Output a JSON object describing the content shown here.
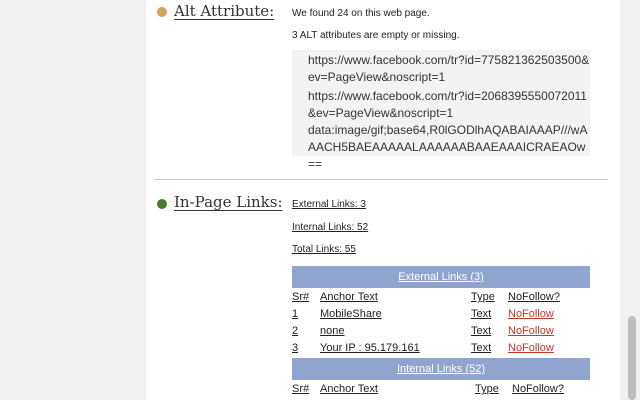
{
  "alt_section": {
    "title": "Alt Attribute:",
    "dot_color": "#d4a45a",
    "found_text": "We found 24 on this web page.",
    "empty_text": "3 ALT attributes are empty or missing.",
    "urls": [
      "https://www.facebook.com/tr?id=775821362503500&ev=PageView&noscript=1",
      "https://www.facebook.com/tr?id=2068395550072011&ev=PageView&noscript=1",
      "data:image/gif;base64,R0lGODlhAQABAIAAAP///wAAACH5BAEAAAAALAAAAAABAAEAAAICRAEAOw=="
    ]
  },
  "links_section": {
    "title": "In-Page Links:",
    "dot_color": "#4a7a2a",
    "external_count": "External Links: 3",
    "internal_count": "Internal Links: 52",
    "total_count": "Total Links: 55",
    "external_header": "External Links (3)",
    "internal_header": "Internal Links (52)",
    "columns": {
      "sr": "Sr#",
      "anchor": "Anchor Text",
      "type": "Type",
      "nofollow": "NoFollow?"
    },
    "external_rows": [
      {
        "sr": "1",
        "anchor": "MobileShare",
        "type": "Text",
        "nofollow": "NoFollow"
      },
      {
        "sr": "2",
        "anchor": "none",
        "type": "Text",
        "nofollow": "NoFollow"
      },
      {
        "sr": "3",
        "anchor": "Your IP : 95.179.161",
        "type": "Text",
        "nofollow": "NoFollow"
      }
    ]
  },
  "colors": {
    "header_bar": "#8fa4cf",
    "nofollow": "#c0392b"
  }
}
